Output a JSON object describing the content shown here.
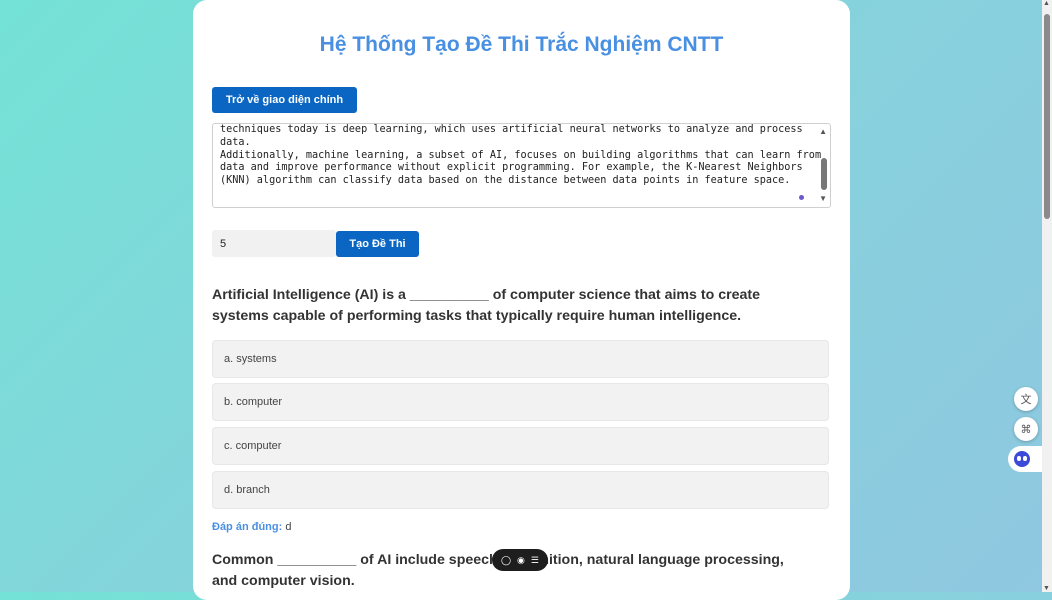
{
  "title": "Hệ Thống Tạo Đề Thi Trắc Nghiệm CNTT",
  "back_button": "Trở về giao diện chính",
  "source_text": {
    "lines": [
      "techniques today is deep learning, which uses artificial neural networks to analyze and process",
      "data.",
      "Additionally, machine learning, a subset of AI, focuses on building algorithms that can learn from",
      "data and improve performance without explicit programming. For example, the K-Nearest Neighbors",
      "(KNN) algorithm can classify data based on the distance between data points in feature space."
    ]
  },
  "question_count": {
    "value": "5"
  },
  "generate_button": "Tạo Đề Thi",
  "questions": [
    {
      "text": "Artificial Intelligence (AI) is a __________ of computer science that aims to create systems capable of performing tasks that typically require human intelligence.",
      "options": [
        "a. systems",
        "b. computer",
        "c. computer",
        "d. branch"
      ],
      "answer_label": "Đáp án đúng:",
      "answer_value": "d"
    },
    {
      "text": "Common __________ of AI include speech recognition, natural language processing, and computer vision."
    }
  ],
  "icons": {
    "floating_toolbar": [
      "chat-icon",
      "copy-icon",
      "menu-icon"
    ],
    "side_panel": [
      "translate-icon",
      "apps-icon",
      "copilot-icon"
    ]
  },
  "colors": {
    "accent": "#4a90e2",
    "button": "#0a66c2",
    "bg_start": "#74e2d6",
    "bg_end": "#8fc7e0"
  }
}
